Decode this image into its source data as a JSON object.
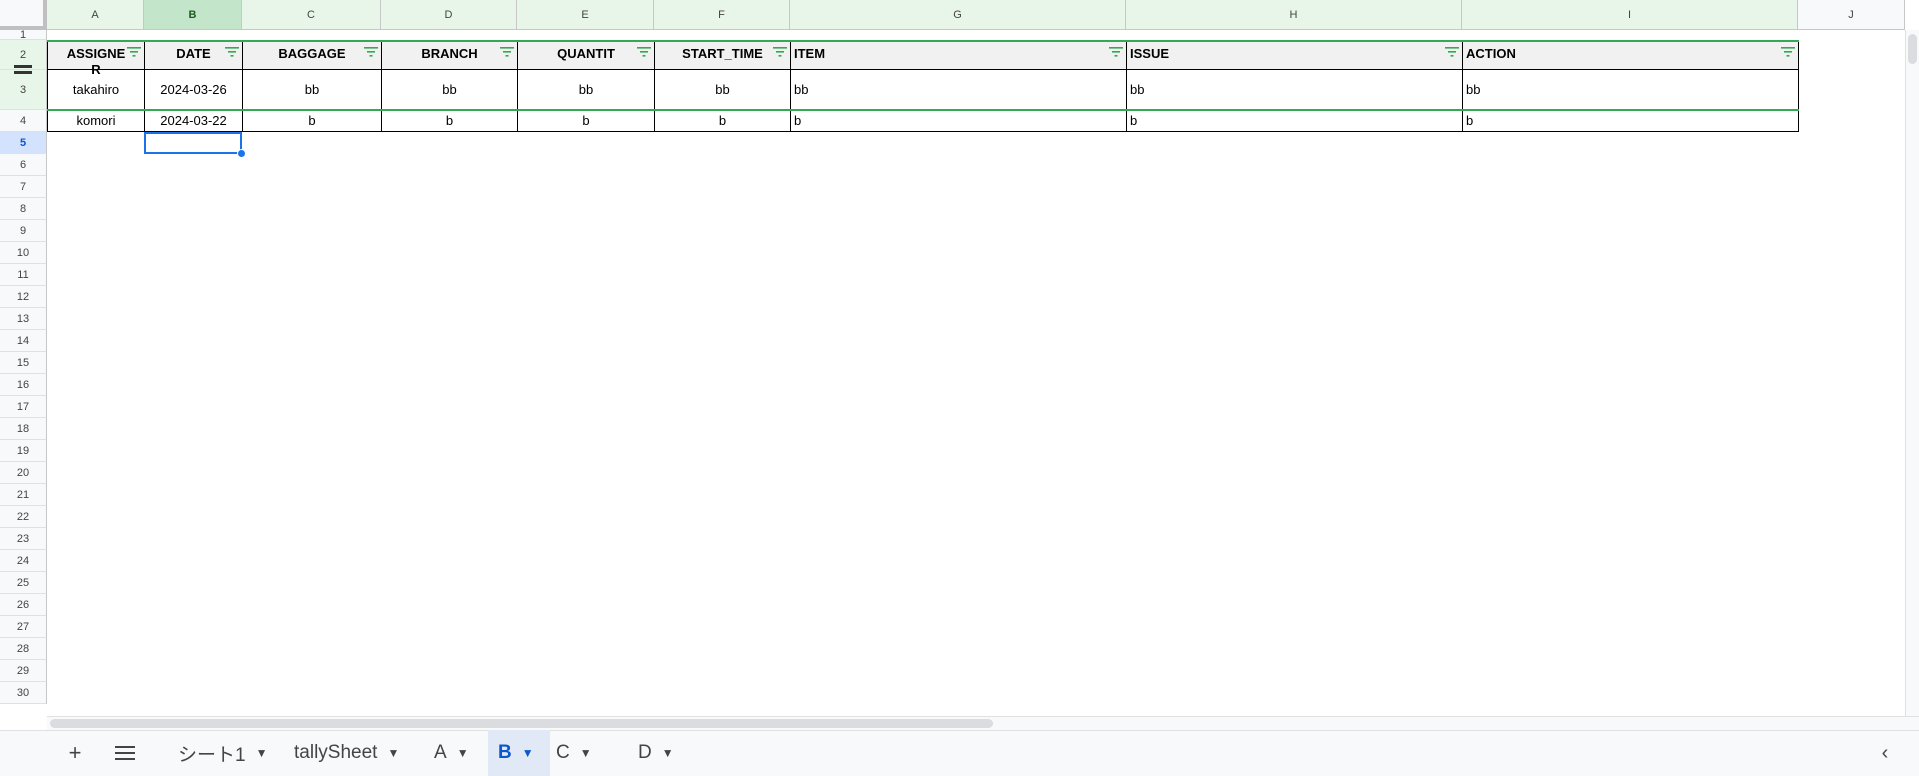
{
  "columns": [
    "A",
    "B",
    "C",
    "D",
    "E",
    "F",
    "G",
    "H",
    "I",
    "J"
  ],
  "row_numbers": [
    "1",
    "2",
    "3",
    "4",
    "5",
    "6",
    "7",
    "8",
    "9",
    "10",
    "11",
    "12",
    "13",
    "14",
    "15",
    "16",
    "17",
    "18",
    "19",
    "20",
    "21",
    "22",
    "23",
    "24",
    "25",
    "26",
    "27",
    "28",
    "29",
    "30"
  ],
  "selected_cell": "B5",
  "table": {
    "headers": [
      "ASSIGNER",
      "DATE",
      "BAGGAGE",
      "BRANCH",
      "QUANTIT",
      "START_TIME",
      "ITEM",
      "ISSUE",
      "ACTION"
    ],
    "rows": [
      [
        "takahiro",
        "2024-03-26",
        "bb",
        "bb",
        "bb",
        "bb",
        "bb",
        "bb",
        "bb"
      ],
      [
        "komori",
        "2024-03-22",
        "b",
        "b",
        "b",
        "b",
        "b",
        "b",
        "b"
      ]
    ]
  },
  "sheet_tabs": [
    {
      "label": "シート1",
      "active": false
    },
    {
      "label": "tallySheet",
      "active": false
    },
    {
      "label": "A",
      "active": false
    },
    {
      "label": "B",
      "active": true
    },
    {
      "label": "C",
      "active": false
    },
    {
      "label": "D",
      "active": false
    }
  ],
  "icons": {
    "add_sheet": "plus-icon",
    "all_sheets": "menu-icon",
    "explore": "chevron-left-icon",
    "filter": "filter-icon"
  },
  "colors": {
    "accent": "#1a73e8",
    "filter_green": "#34a853",
    "header_bg": "#f1f1f1",
    "active_tab_text": "#0b57d0"
  }
}
